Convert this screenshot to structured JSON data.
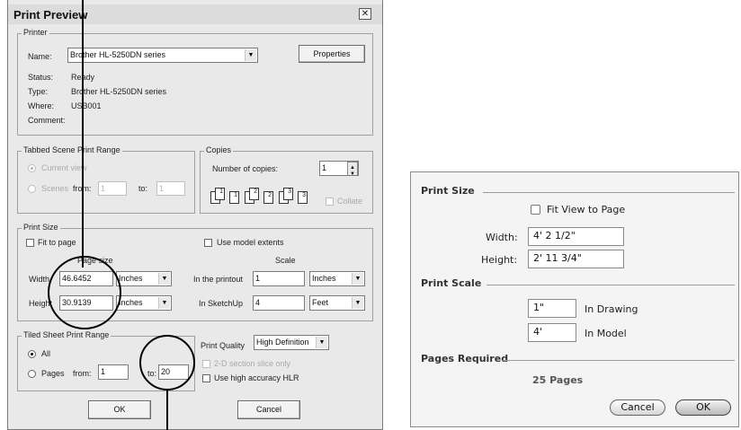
{
  "print_preview": {
    "title": "Print Preview",
    "close_glyph": "✕",
    "printer": {
      "group_label": "Printer",
      "name_label": "Name:",
      "name_value": "Brother HL-5250DN series",
      "properties_label": "Properties",
      "status_label": "Status:",
      "status_value": "Ready",
      "type_label": "Type:",
      "type_value": "Brother HL-5250DN series",
      "where_label": "Where:",
      "where_value": "USB001",
      "comment_label": "Comment:"
    },
    "tabbed_range": {
      "group_label": "Tabbed Scene Print Range",
      "current_view_label": "Current view",
      "scenes_label": "Scenes",
      "from_label": "from:",
      "from_value": "1",
      "to_label": "to:",
      "to_value": "1"
    },
    "copies": {
      "group_label": "Copies",
      "number_label": "Number of copies:",
      "number_value": "1",
      "collate_label": "Collate",
      "page_nums": [
        "1",
        "1",
        "2",
        "2",
        "3",
        "3"
      ]
    },
    "print_size": {
      "group_label": "Print Size",
      "fit_to_page_label": "Fit to page",
      "use_model_extents_label": "Use model extents",
      "page_size_header": "Page size",
      "scale_header": "Scale",
      "width_label": "Width",
      "width_value": "46.6452",
      "width_unit": "Inches",
      "height_label": "Height",
      "height_value": "30.9139",
      "height_unit": "Inches",
      "printout_label": "In the printout",
      "printout_value": "1",
      "printout_unit": "Inches",
      "sketchup_label": "In SketchUp",
      "sketchup_value": "4",
      "sketchup_unit": "Feet"
    },
    "tiled_range": {
      "group_label": "Tiled Sheet Print Range",
      "all_label": "All",
      "pages_label": "Pages",
      "from_label": "from:",
      "from_value": "1",
      "to_label": "to:",
      "to_value": "20"
    },
    "quality": {
      "label": "Print Quality",
      "value": "High Definition",
      "section_slice_label": "2-D section slice only",
      "hlr_label": "Use high accuracy HLR"
    },
    "ok_label": "OK",
    "cancel_label": "Cancel"
  },
  "mac_dialog": {
    "print_size_label": "Print Size",
    "fit_view_label": "Fit View to Page",
    "width_label": "Width:",
    "width_value": "4' 2 1/2\"",
    "height_label": "Height:",
    "height_value": "2' 11 3/4\"",
    "print_scale_label": "Print Scale",
    "drawing_value": "1\"",
    "drawing_label": "In Drawing",
    "model_value": "4'",
    "model_label": "In Model",
    "pages_required_label": "Pages Required",
    "pages_value": "25 Pages",
    "cancel_label": "Cancel",
    "ok_label": "OK"
  }
}
